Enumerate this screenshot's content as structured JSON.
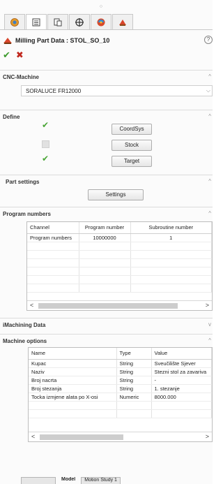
{
  "window": {
    "title": "Milling Part Data : STOL_SO_10"
  },
  "tabs": [
    {
      "name": "appearance-tab-icon"
    },
    {
      "name": "feature-manager-tab-icon"
    },
    {
      "name": "property-manager-tab-icon"
    },
    {
      "name": "configuration-manager-tab-icon"
    },
    {
      "name": "display-manager-tab-icon"
    },
    {
      "name": "camworks-tab-icon"
    }
  ],
  "cnc_machine": {
    "header": "CNC-Machine",
    "selected": "SORALUCE FR12000"
  },
  "define": {
    "header": "Define",
    "buttons": [
      {
        "label": "CoordSys",
        "status": "done"
      },
      {
        "label": "Stock",
        "status": "none"
      },
      {
        "label": "Target",
        "status": "done"
      }
    ]
  },
  "part_settings": {
    "header": "Part settings",
    "button": "Settings"
  },
  "program_numbers": {
    "header": "Program numbers",
    "columns": [
      "Channel",
      "Program number",
      "Subroutine number"
    ],
    "rows": [
      [
        "Program numbers",
        "10000000",
        "1"
      ]
    ]
  },
  "imachining": {
    "header": "iMachining Data"
  },
  "machine_options": {
    "header": "Machine options",
    "columns": [
      "Name",
      "Type",
      "Value"
    ],
    "rows": [
      [
        "Kupac",
        "String",
        "Sveučilište Sjever"
      ],
      [
        "Naziv",
        "String",
        "Stezni stol za zavariva"
      ],
      [
        "Broj nacrta",
        "String",
        "-"
      ],
      [
        "Broj stezanja",
        "String",
        "1. stezanje"
      ],
      [
        "Tocka izmjene alata po X-osi",
        "Numeric",
        "8000.000"
      ]
    ]
  },
  "bottom_tabs": [
    "Model",
    "Motion Study 1"
  ],
  "colors": {
    "ok": "#3c9a2c",
    "cancel": "#c0281e",
    "check": "#4aa637"
  }
}
